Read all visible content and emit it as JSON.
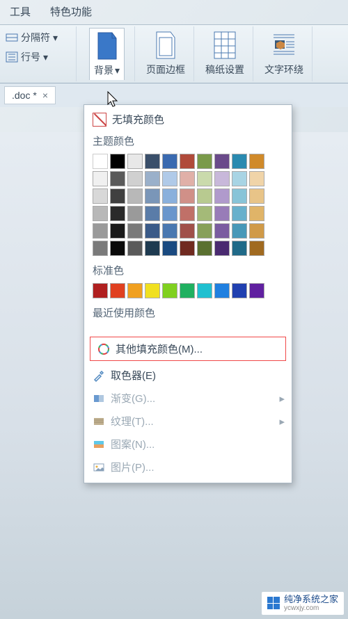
{
  "menu": {
    "tools": "工具",
    "special": "特色功能"
  },
  "ribbon": {
    "separator": "分隔符",
    "line_number": "行号",
    "background": "背景",
    "page_border": "页面边框",
    "paper_setup": "稿纸设置",
    "text_wrap": "文字环绕"
  },
  "tab": {
    "name": ".doc *",
    "close": "×"
  },
  "dropdown": {
    "no_fill": "无填充颜色",
    "theme_colors": "主题颜色",
    "standard_colors": "标准色",
    "recent_colors": "最近使用颜色",
    "more_fill": "其他填充颜色(M)...",
    "eyedropper": "取色器(E)",
    "gradient": "渐变(G)...",
    "texture": "纹理(T)...",
    "pattern": "图案(N)...",
    "picture": "图片(P)..."
  },
  "theme_palette": [
    [
      "#ffffff",
      "#000000",
      "#e8e8e8",
      "#3a4f6a",
      "#3a6ab0",
      "#b04a3a",
      "#7a9a4a",
      "#6a4a8a",
      "#2a8ab0",
      "#d08a2a"
    ],
    [
      "#f0f0f0",
      "#5a5a5a",
      "#d0d0d0",
      "#9ab0ca",
      "#b0cae8",
      "#e0b0a8",
      "#cadaac",
      "#c8b8da",
      "#a8d4e4",
      "#f0d4a8"
    ],
    [
      "#d8d8d8",
      "#404040",
      "#b8b8b8",
      "#7a96b8",
      "#8ab0dc",
      "#d09088",
      "#b8ca90",
      "#b09acc",
      "#88c4d8",
      "#e8c488"
    ],
    [
      "#b8b8b8",
      "#2a2a2a",
      "#9a9a9a",
      "#5a7ca8",
      "#6a96cc",
      "#c07068",
      "#a4ba78",
      "#987cb8",
      "#68b0cc",
      "#e0b468"
    ],
    [
      "#9a9a9a",
      "#1a1a1a",
      "#7a7a7a",
      "#3a5a88",
      "#4a78b0",
      "#a0504a",
      "#88a05a",
      "#7a5ca0",
      "#4898b8",
      "#d09a48"
    ],
    [
      "#7a7a7a",
      "#0a0a0a",
      "#5a5a5a",
      "#1e3a50",
      "#1a4a80",
      "#702a20",
      "#5a7030",
      "#4a2a70",
      "#206a88",
      "#a06a20"
    ]
  ],
  "standard_palette": [
    "#b02020",
    "#e04020",
    "#f0a020",
    "#f0e020",
    "#80d020",
    "#20b060",
    "#20c0d0",
    "#2080e0",
    "#2040b0",
    "#6020a0"
  ],
  "watermark": {
    "name": "纯净系统之家",
    "url": "ycwxjy.com"
  }
}
